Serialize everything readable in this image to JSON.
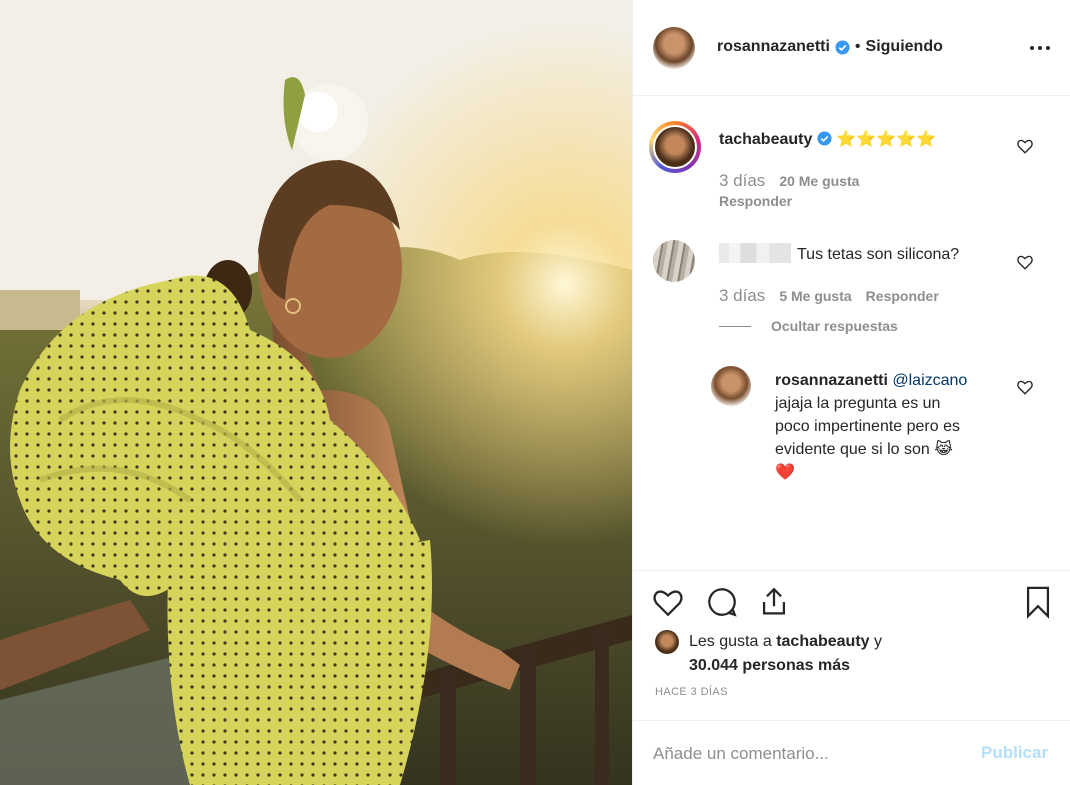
{
  "header": {
    "username": "rosannazanetti",
    "separator": "•",
    "follow_status": "Siguiendo"
  },
  "comments": [
    {
      "username": "tachabeauty",
      "text": "⭐⭐⭐⭐⭐",
      "time": "3 días",
      "likes": "20 Me gusta",
      "reply": "Responder"
    },
    {
      "username_blurred": true,
      "text": "Tus tetas son silicona?",
      "time": "3 días",
      "likes": "5 Me gusta",
      "reply": "Responder",
      "hide_replies": "Ocultar respuestas"
    }
  ],
  "reply": {
    "username": "rosannazanetti",
    "mention": "@laizcano",
    "text_lines": [
      "jajaja la pregunta es un",
      "poco impertinente pero es",
      "evidente que si lo son 😹",
      "❤️"
    ]
  },
  "likes": {
    "prefix": "Les gusta a",
    "user": "tachabeauty",
    "conjunction": "y",
    "count_text": "30.044 personas más"
  },
  "time_ago": "HACE 3 DÍAS",
  "comment_input": {
    "placeholder": "Añade un comentario..."
  },
  "publish_label": "Publicar",
  "colors": {
    "link": "#00376b",
    "verified": "#3897f0",
    "publish_disabled": "#b2dffc",
    "muted": "#8e8e8e",
    "dress": "#d8d65a"
  },
  "icons": [
    "more-options-icon",
    "heart-icon",
    "comment-icon",
    "share-icon",
    "bookmark-icon",
    "verified-icon"
  ]
}
